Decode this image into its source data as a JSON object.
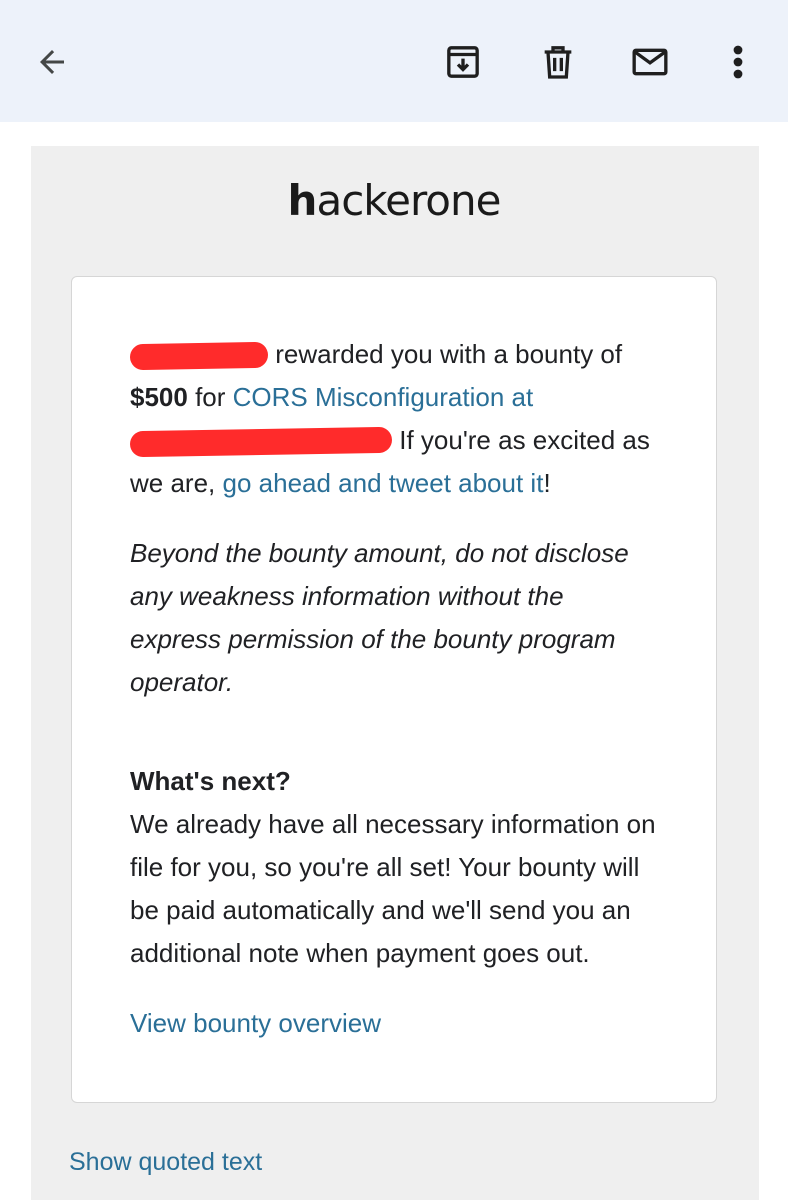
{
  "toolbar": {
    "back_icon": "arrow-left-icon",
    "archive_icon": "archive-icon",
    "delete_icon": "trash-icon",
    "mark_unread_icon": "mail-icon",
    "more_icon": "more-vert-icon"
  },
  "email": {
    "logo": {
      "part1": "h",
      "part2": "ackerone"
    },
    "paragraph1": {
      "text_after_redaction": " rewarded you with a bounty of",
      "amount": "$500",
      "for_word": " for ",
      "report_link": "CORS Misconfiguration at",
      "after_redaction_2": " If you're as excited as",
      "we_are": "we are, ",
      "tweet_link": "go ahead and tweet about it",
      "exclaim": "!"
    },
    "disclaimer": "Beyond the bounty amount, do not disclose any weakness information without the express permission of the bounty program operator.",
    "next_heading": "What's next?",
    "next_body": "We already have all necessary information on file for you, so you're all set! Your bounty will be paid automatically and we'll send you an additional note when payment goes out.",
    "overview_link": "View bounty overview",
    "show_quoted": "Show quoted text"
  },
  "colors": {
    "appbar": "#edf2fa",
    "link": "#2a6f97",
    "redaction": "#ff2b2b"
  }
}
